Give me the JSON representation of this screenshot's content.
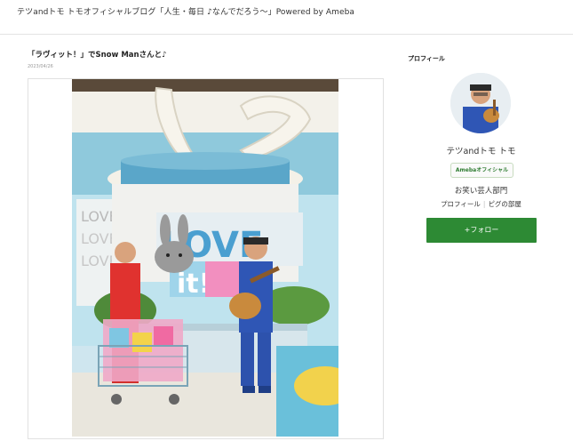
{
  "header": {
    "blog_title": "テツandトモ トモオフィシャルブログ「人生・毎日 ♪なんでだろう〜」Powered by Ameba"
  },
  "entry": {
    "title": "「ラヴィット！」でSnow Manさんと♪",
    "date": "2023/04/26"
  },
  "sidebar": {
    "section_title": "プロフィール",
    "profile_name": "テツandトモ トモ",
    "badge": "Amebaオフィシャル",
    "genre": "お笑い芸人部門",
    "link_profile": "プロフィール",
    "link_separator": "|",
    "link_pigg": "ピグの部屋",
    "follow_label": "+フォロー"
  },
  "colors": {
    "accent_green": "#2d8a34",
    "border": "#e3e3e3"
  }
}
